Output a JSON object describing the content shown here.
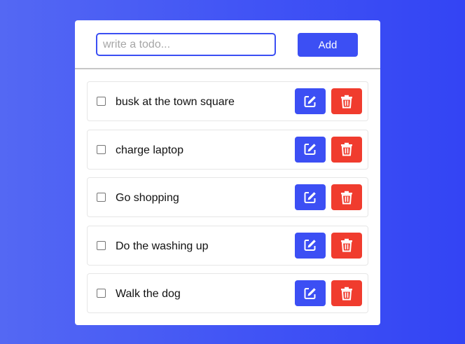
{
  "input": {
    "placeholder": "write a todo...",
    "value": ""
  },
  "add_button": {
    "label": "Add"
  },
  "todos": [
    {
      "text": "busk at the town square",
      "done": false
    },
    {
      "text": "charge laptop",
      "done": false
    },
    {
      "text": "Go shopping",
      "done": false
    },
    {
      "text": "Do the washing up",
      "done": false
    },
    {
      "text": "Walk the dog",
      "done": false
    }
  ],
  "icons": {
    "edit": "edit-icon",
    "delete": "trash-icon"
  },
  "colors": {
    "accent": "#3c4ff4",
    "danger": "#f03c2e"
  }
}
